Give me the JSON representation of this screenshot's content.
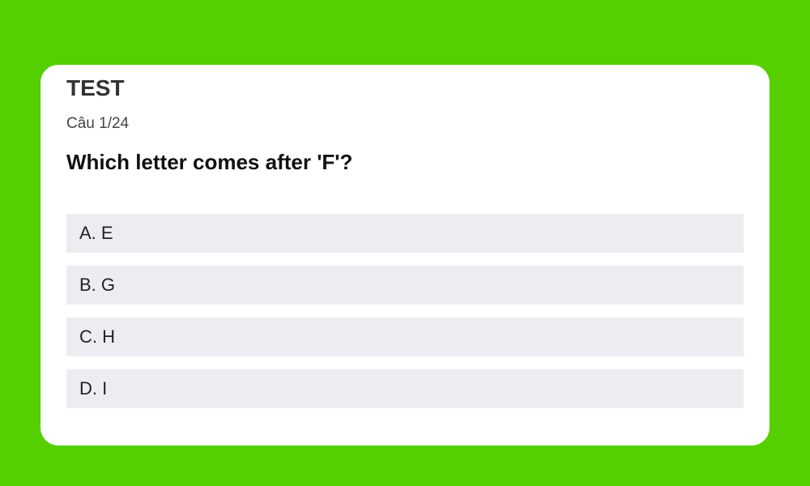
{
  "quiz": {
    "title": "TEST",
    "counter": "Câu 1/24",
    "question": "Which letter comes after 'F'?",
    "options": [
      {
        "label": "A. E"
      },
      {
        "label": "B. G"
      },
      {
        "label": "C. H"
      },
      {
        "label": "D. I"
      }
    ]
  },
  "colors": {
    "background": "#56cf00",
    "card": "#ffffff",
    "option": "#ecedf1"
  }
}
